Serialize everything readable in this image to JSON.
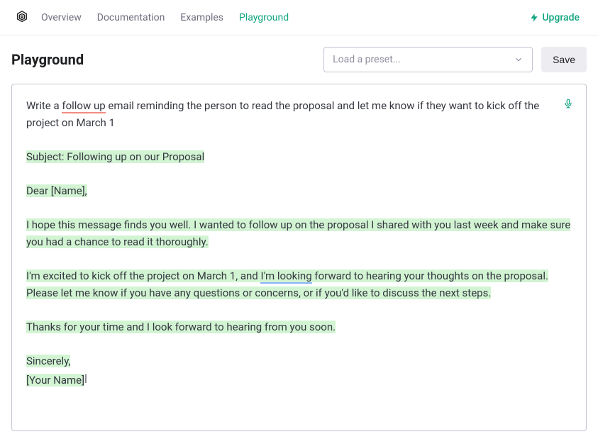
{
  "nav": {
    "links": [
      "Overview",
      "Documentation",
      "Examples",
      "Playground"
    ],
    "upgrade": "Upgrade"
  },
  "header": {
    "title": "Playground",
    "preset_placeholder": "Load a preset...",
    "save_label": "Save"
  },
  "editor": {
    "prompt_pre": "Write a ",
    "prompt_spell": "follow up",
    "prompt_post": " email reminding the person to read the proposal and let me know if they want to kick off the project on March 1",
    "subject": "Subject: Following up on our Proposal",
    "greeting": "Dear [Name],",
    "p1": "I hope this message finds you well. I wanted to follow up on the proposal I shared with you last week and make sure you had a chance to read it thoroughly.",
    "p2_pre": "I'm excited to kick off the project on March 1, and ",
    "p2_grammar": "I'm looking",
    "p2_post": " forward to hearing your thoughts on the proposal. Please let me know if you have any questions or concerns, or if you'd like to discuss the next steps.",
    "p3": "Thanks for your time and I look forward to hearing from you soon.",
    "signoff": "Sincerely,",
    "signature": "[Your Name]"
  }
}
